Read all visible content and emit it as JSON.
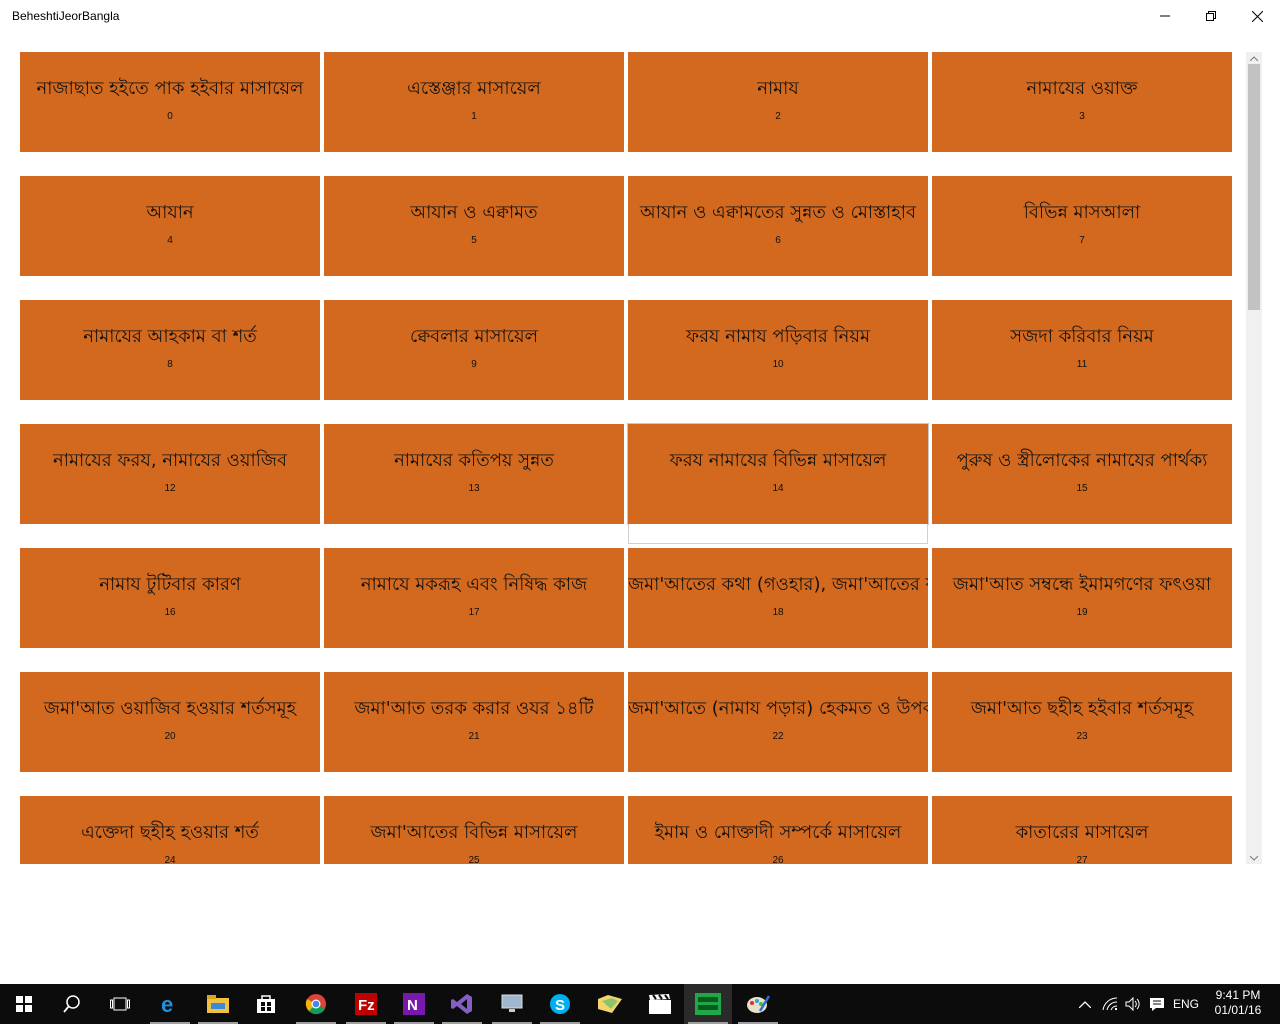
{
  "window": {
    "title": "BeheshtiJeorBangla"
  },
  "tiles": [
    {
      "title": "নাজাছাত হইতে পাক হইবার মাসায়েল",
      "index": "0"
    },
    {
      "title": "এস্তেঞ্জার মাসায়েল",
      "index": "1"
    },
    {
      "title": "নামায",
      "index": "2"
    },
    {
      "title": "নামাযের ওয়াক্ত",
      "index": "3"
    },
    {
      "title": "আযান",
      "index": "4"
    },
    {
      "title": "আযান ও এক্বামত",
      "index": "5"
    },
    {
      "title": "আযান ও এক্বামতের সুন্নত ও মোস্তাহাব",
      "index": "6"
    },
    {
      "title": "বিভিন্ন মাসআলা",
      "index": "7"
    },
    {
      "title": "নামাযের আহকাম বা শর্ত",
      "index": "8"
    },
    {
      "title": "ক্বেবলার মাসায়েল",
      "index": "9"
    },
    {
      "title": "ফরয নামায পড়িবার নিয়ম",
      "index": "10"
    },
    {
      "title": "সজদা করিবার নিয়ম",
      "index": "11"
    },
    {
      "title": "নামাযের ফরয, নামাযের ওয়াজিব",
      "index": "12"
    },
    {
      "title": "নামাযের কতিপয় সুন্নত",
      "index": "13"
    },
    {
      "title": "ফরয নামাযের বিভিন্ন মাসায়েল",
      "index": "14"
    },
    {
      "title": "পুরুষ ও স্ত্রীলোকের নামাযের পার্থক্য",
      "index": "15"
    },
    {
      "title": "নামায টুটিবার কারণ",
      "index": "16"
    },
    {
      "title": "নামাযে মকরূহ এবং নিষিদ্ধ কাজ",
      "index": "17"
    },
    {
      "title": "জমা'আতের কথা (গওহার), জমা'আতের ফযীলত ও তাকীদ",
      "index": "18"
    },
    {
      "title": "জমা'আত সম্বন্ধে ইমামগণের ফৎওয়া",
      "index": "19"
    },
    {
      "title": "জমা'আত ওয়াজিব হওয়ার শর্তসমূহ",
      "index": "20"
    },
    {
      "title": "জমা'আত তরক করার ওযর ১৪টি",
      "index": "21"
    },
    {
      "title": "জমা'আতে (নামায পড়ার) হেকমত ও উপকারিতা",
      "index": "22"
    },
    {
      "title": "জমা'আত ছহীহ হইবার শর্তসমূহ",
      "index": "23"
    },
    {
      "title": "এক্তেদা ছহীহ হওয়ার শর্ত",
      "index": "24"
    },
    {
      "title": "জমা'আতের বিভিন্ন মাসায়েল",
      "index": "25"
    },
    {
      "title": "ইমাম ও মোক্তাদী সম্পর্কে মাসায়েল",
      "index": "26"
    },
    {
      "title": "কাতারের মাসায়েল",
      "index": "27"
    }
  ],
  "taskbar": {
    "apps": [
      "start-icon",
      "search-icon",
      "task-view-icon",
      "edge-icon",
      "file-explorer-icon",
      "store-icon",
      "chrome-icon",
      "filezilla-icon",
      "onenote-icon",
      "visual-studio-icon",
      "remote-desktop-icon",
      "skype-icon",
      "folder-icon",
      "movies-icon",
      "beheshtijeor-app-icon",
      "paint-icon"
    ],
    "language": "ENG",
    "time": "9:41 PM",
    "date": "01/01/16"
  },
  "colors": {
    "tile": "#d2691e",
    "taskbar": "#0c0c0c"
  }
}
